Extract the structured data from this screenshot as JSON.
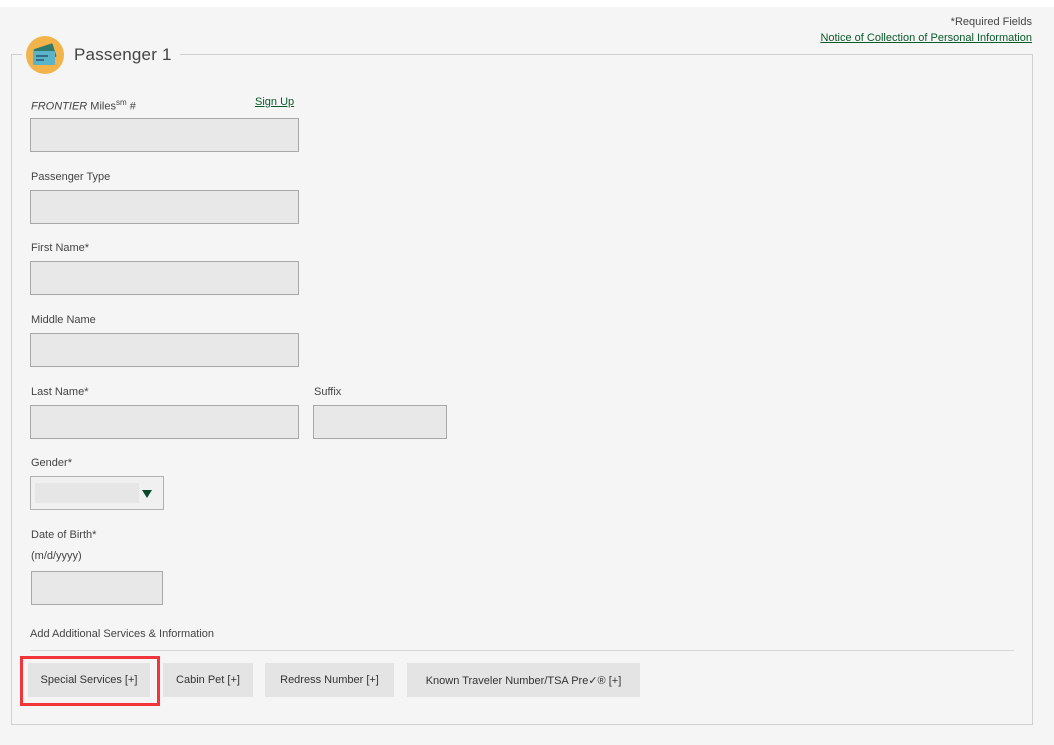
{
  "header": {
    "required_note": "*Required Fields",
    "notice_link": "Notice of Collection of Personal Information"
  },
  "passenger": {
    "title": "Passenger 1",
    "icon": "boarding-pass-icon"
  },
  "fields": {
    "frontier_brand": "FRONTIER",
    "frontier_miles_label": " Miles",
    "frontier_miles_sup": "sm",
    "frontier_miles_suffix": " #",
    "signup_label": "Sign Up",
    "frontier_miles_value": "",
    "passenger_type_label": "Passenger Type",
    "passenger_type_value": "",
    "first_name_label": "First Name*",
    "first_name_value": "",
    "middle_name_label": "Middle Name",
    "middle_name_value": "",
    "last_name_label": "Last Name*",
    "last_name_value": "",
    "suffix_label": "Suffix",
    "suffix_value": "",
    "gender_label": "Gender*",
    "gender_value": "",
    "dob_label": "Date of Birth*",
    "dob_format": "(m/d/yyyy)",
    "dob_value": ""
  },
  "additional": {
    "heading": "Add Additional Services & Information",
    "buttons": [
      {
        "label": "Special Services [+]"
      },
      {
        "label": "Cabin Pet [+]"
      },
      {
        "label": "Redress Number [+]"
      },
      {
        "label": "Known Traveler Number/TSA Pre✓® [+]"
      }
    ]
  },
  "colors": {
    "accent_link": "#0a5a2c",
    "highlight": "#f2353a",
    "icon_bg": "#f2b34a"
  }
}
